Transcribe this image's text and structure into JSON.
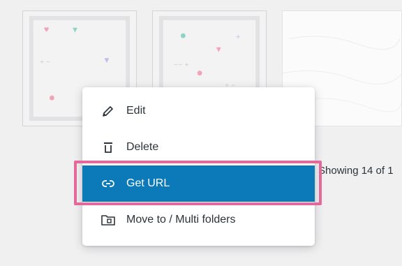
{
  "status_text": "Showing 14 of 1",
  "menu": {
    "items": [
      {
        "label": "Edit",
        "icon": "pencil-icon"
      },
      {
        "label": "Delete",
        "icon": "trash-icon"
      },
      {
        "label": "Get URL",
        "icon": "link-icon"
      },
      {
        "label": "Move to / Multi folders",
        "icon": "folder-icon"
      }
    ]
  },
  "colors": {
    "selected_item_bg": "#0c7ab8",
    "highlight_border": "#e5689b"
  }
}
